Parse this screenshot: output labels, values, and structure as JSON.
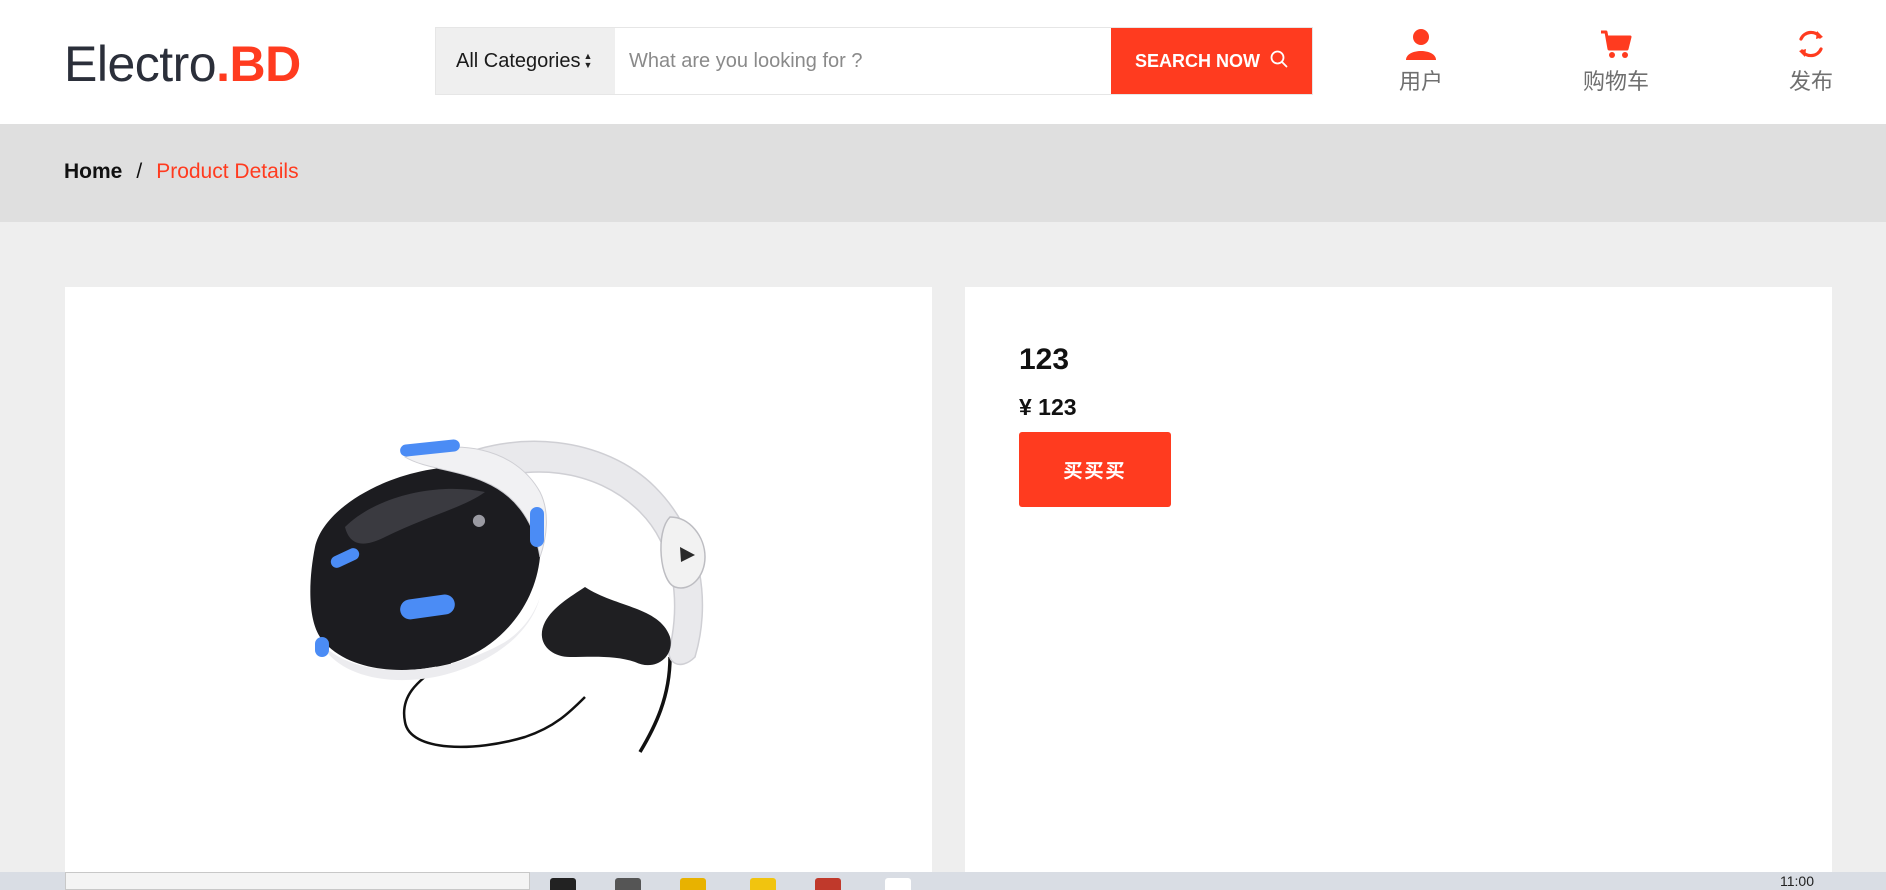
{
  "header": {
    "logo_main": "Electro",
    "logo_accent": ".BD",
    "search": {
      "category_label": "All Categories",
      "placeholder": "What are you looking for ?",
      "button_label": "SEARCH NOW"
    },
    "actions": {
      "user_label": "用户",
      "cart_label": "购物车",
      "publish_label": "发布"
    }
  },
  "breadcrumb": {
    "home": "Home",
    "separator": "/",
    "current": "Product Details"
  },
  "product": {
    "name": "123",
    "price": "¥ 123",
    "buy_label": "买买买"
  },
  "taskbar": {
    "clock": "11:00"
  },
  "colors": {
    "accent": "#ff3b1f",
    "header_bg": "#ffffff",
    "breadcrumb_bg": "#dfdfdf",
    "page_bg": "#eeeeee"
  },
  "icons": {
    "search_button": "search-icon",
    "user": "user-icon",
    "cart": "cart-icon",
    "publish": "refresh-icon",
    "category_select": "sort-arrows-icon"
  }
}
